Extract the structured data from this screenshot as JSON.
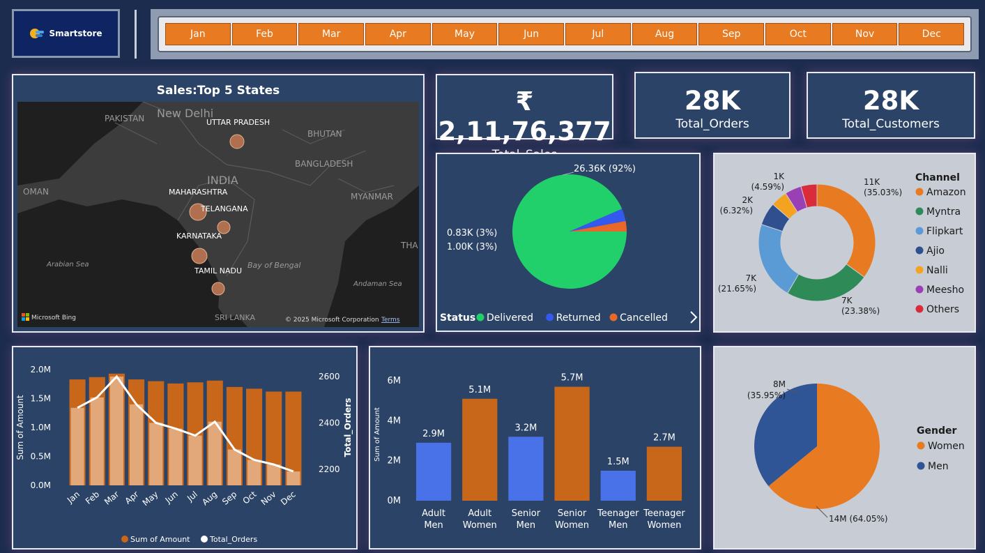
{
  "header": {
    "brand": "Smartstore",
    "months": [
      "Jan",
      "Feb",
      "Mar",
      "Apr",
      "May",
      "Jun",
      "Jul",
      "Aug",
      "Sep",
      "Oct",
      "Nov",
      "Dec"
    ]
  },
  "kpis": {
    "total_sales": {
      "value": "₹ 2,11,76,377",
      "label": "Total_Sales"
    },
    "total_orders": {
      "value": "28K",
      "label": "Total_Orders"
    },
    "total_customers": {
      "value": "28K",
      "label": "Total_Customers"
    }
  },
  "map": {
    "title": "Sales:Top 5 States",
    "countries": [
      "PAKISTAN",
      "New Delhi",
      "INDIA",
      "BHUTAN",
      "BANGLADESH",
      "MYANMAR",
      "OMAN",
      "THA",
      "Arabian Sea",
      "Bay of Bengal",
      "Andaman Sea",
      "SRI LANKA"
    ],
    "states": [
      "UTTAR PRADESH",
      "MAHARASHTRA",
      "TELANGANA",
      "KARNATAKA",
      "TAMIL NADU"
    ],
    "attribution_left": "Microsoft Bing",
    "attribution_right": "© 2025 Microsoft Corporation",
    "terms": "Terms"
  },
  "chart_data": [
    {
      "type": "pie",
      "name": "status",
      "legend_title": "Status",
      "labels": [
        "Delivered",
        "Returned",
        "Cancelled"
      ],
      "values": [
        26.36,
        1.0,
        0.83
      ],
      "data_labels": [
        "26.36K (92%)",
        "1.00K (3%)",
        "0.83K (3%)"
      ],
      "colors": [
        "#21cf6b",
        "#3558ee",
        "#e8682a"
      ],
      "legend_position": "bottom"
    },
    {
      "type": "pie",
      "name": "channel",
      "donut": true,
      "legend_title": "Channel",
      "labels": [
        "Amazon",
        "Myntra",
        "Flipkart",
        "Ajio",
        "Nalli",
        "Meesho",
        "Others"
      ],
      "values": [
        35.03,
        23.38,
        21.65,
        6.32,
        4.59,
        4.59,
        4.44
      ],
      "data_labels": [
        "11K\n(35.03%)",
        "7K\n(23.38%)",
        "7K\n(21.65%)",
        "2K\n(6.32%)",
        "",
        "1K\n(4.59%)",
        ""
      ],
      "colors": [
        "#e87a22",
        "#2e8b57",
        "#5b9bd5",
        "#2f4f8f",
        "#f3a320",
        "#9b3fb5",
        "#d92b3a"
      ],
      "legend_position": "right"
    },
    {
      "type": "bar",
      "name": "monthly",
      "categories": [
        "Jan",
        "Feb",
        "Mar",
        "Apr",
        "May",
        "Jun",
        "Jul",
        "Aug",
        "Sep",
        "Oct",
        "Nov",
        "Dec"
      ],
      "series": [
        {
          "name": "Sum of Amount",
          "type": "bar",
          "values": [
            1.83,
            1.87,
            1.93,
            1.83,
            1.8,
            1.76,
            1.78,
            1.81,
            1.7,
            1.67,
            1.62,
            1.62
          ],
          "color": "#c8661a"
        },
        {
          "name": "Total_Orders",
          "type": "line",
          "axis": "right",
          "values": [
            2465,
            2510,
            2600,
            2480,
            2400,
            2375,
            2345,
            2405,
            2285,
            2240,
            2220,
            2190
          ],
          "color": "#ffffff"
        }
      ],
      "ylabel": "Sum of Amount",
      "y2label": "Total_Orders",
      "ylim": [
        0,
        2.0
      ],
      "y2lim": [
        2130,
        2630
      ],
      "yticks": [
        "0.0M",
        "0.5M",
        "1.0M",
        "1.5M",
        "2.0M"
      ],
      "y2ticks": [
        "2200",
        "2400",
        "2600"
      ],
      "legend_position": "bottom"
    },
    {
      "type": "bar",
      "name": "age_gender",
      "categories": [
        "Adult Men",
        "Adult Women",
        "Senior Men",
        "Senior Women",
        "Teenager Men",
        "Teenager Women"
      ],
      "values": [
        2.9,
        5.1,
        3.2,
        5.7,
        1.5,
        2.7
      ],
      "data_labels": [
        "2.9M",
        "5.1M",
        "3.2M",
        "5.7M",
        "1.5M",
        "2.7M"
      ],
      "colors": [
        "#4a72e8",
        "#c8661a",
        "#4a72e8",
        "#c8661a",
        "#4a72e8",
        "#c8661a"
      ],
      "ylabel": "Sum of Amount",
      "ylim": [
        0,
        6
      ],
      "yticks": [
        "0M",
        "2M",
        "4M",
        "6M"
      ]
    },
    {
      "type": "pie",
      "name": "gender",
      "legend_title": "Gender",
      "labels": [
        "Women",
        "Men"
      ],
      "values": [
        64.05,
        35.95
      ],
      "data_labels": [
        "14M (64.05%)",
        "8M\n(35.95%)"
      ],
      "colors": [
        "#e87a22",
        "#2f5597"
      ],
      "legend_position": "right"
    }
  ]
}
